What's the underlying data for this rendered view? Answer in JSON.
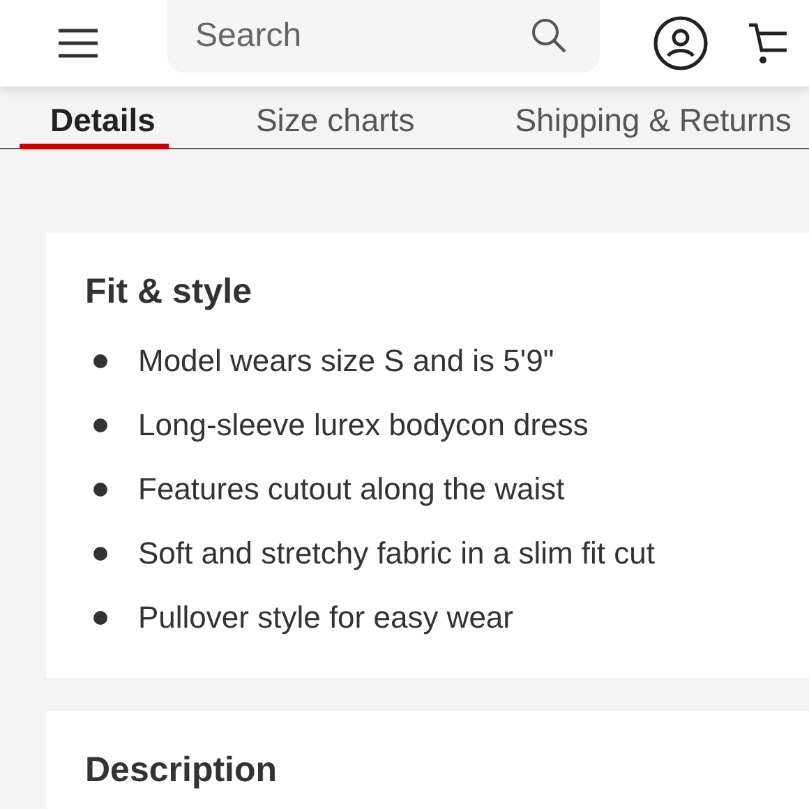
{
  "header": {
    "search": {
      "placeholder": "Search"
    }
  },
  "tabs": [
    {
      "label": "Details",
      "selected": true
    },
    {
      "label": "Size charts",
      "selected": false
    },
    {
      "label": "Shipping & Returns",
      "selected": false
    }
  ],
  "sections": [
    {
      "title": "Fit & style",
      "bullets": [
        "Model wears size S and is 5'9\"",
        "Long-sleeve lurex bodycon dress",
        "Features cutout along the waist",
        "Soft and stretchy fabric in a slim fit cut",
        "Pullover style for easy wear"
      ]
    },
    {
      "title": "Description"
    }
  ]
}
